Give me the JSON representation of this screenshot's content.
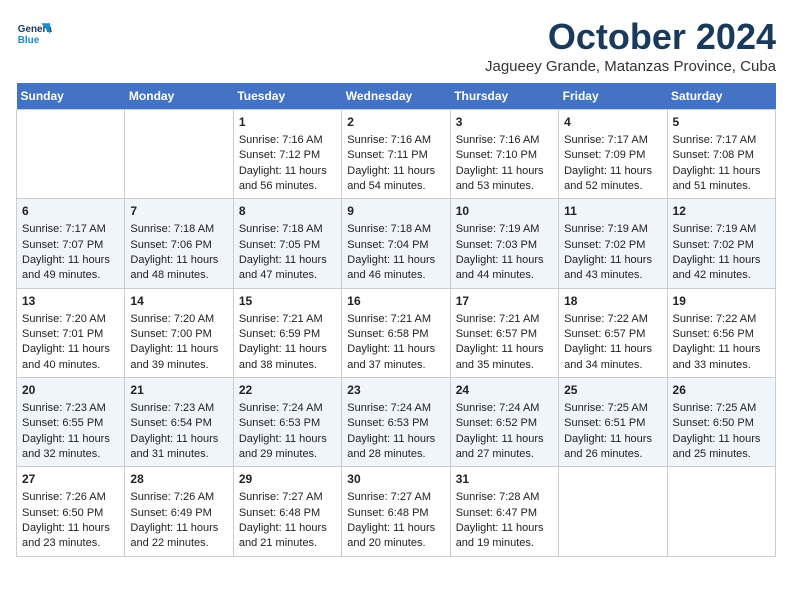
{
  "header": {
    "logo_line1": "General",
    "logo_line2": "Blue",
    "month": "October 2024",
    "location": "Jagueey Grande, Matanzas Province, Cuba"
  },
  "days_of_week": [
    "Sunday",
    "Monday",
    "Tuesday",
    "Wednesday",
    "Thursday",
    "Friday",
    "Saturday"
  ],
  "weeks": [
    [
      {
        "day": "",
        "sunrise": "",
        "sunset": "",
        "daylight": ""
      },
      {
        "day": "",
        "sunrise": "",
        "sunset": "",
        "daylight": ""
      },
      {
        "day": "1",
        "sunrise": "Sunrise: 7:16 AM",
        "sunset": "Sunset: 7:12 PM",
        "daylight": "Daylight: 11 hours and 56 minutes."
      },
      {
        "day": "2",
        "sunrise": "Sunrise: 7:16 AM",
        "sunset": "Sunset: 7:11 PM",
        "daylight": "Daylight: 11 hours and 54 minutes."
      },
      {
        "day": "3",
        "sunrise": "Sunrise: 7:16 AM",
        "sunset": "Sunset: 7:10 PM",
        "daylight": "Daylight: 11 hours and 53 minutes."
      },
      {
        "day": "4",
        "sunrise": "Sunrise: 7:17 AM",
        "sunset": "Sunset: 7:09 PM",
        "daylight": "Daylight: 11 hours and 52 minutes."
      },
      {
        "day": "5",
        "sunrise": "Sunrise: 7:17 AM",
        "sunset": "Sunset: 7:08 PM",
        "daylight": "Daylight: 11 hours and 51 minutes."
      }
    ],
    [
      {
        "day": "6",
        "sunrise": "Sunrise: 7:17 AM",
        "sunset": "Sunset: 7:07 PM",
        "daylight": "Daylight: 11 hours and 49 minutes."
      },
      {
        "day": "7",
        "sunrise": "Sunrise: 7:18 AM",
        "sunset": "Sunset: 7:06 PM",
        "daylight": "Daylight: 11 hours and 48 minutes."
      },
      {
        "day": "8",
        "sunrise": "Sunrise: 7:18 AM",
        "sunset": "Sunset: 7:05 PM",
        "daylight": "Daylight: 11 hours and 47 minutes."
      },
      {
        "day": "9",
        "sunrise": "Sunrise: 7:18 AM",
        "sunset": "Sunset: 7:04 PM",
        "daylight": "Daylight: 11 hours and 46 minutes."
      },
      {
        "day": "10",
        "sunrise": "Sunrise: 7:19 AM",
        "sunset": "Sunset: 7:03 PM",
        "daylight": "Daylight: 11 hours and 44 minutes."
      },
      {
        "day": "11",
        "sunrise": "Sunrise: 7:19 AM",
        "sunset": "Sunset: 7:02 PM",
        "daylight": "Daylight: 11 hours and 43 minutes."
      },
      {
        "day": "12",
        "sunrise": "Sunrise: 7:19 AM",
        "sunset": "Sunset: 7:02 PM",
        "daylight": "Daylight: 11 hours and 42 minutes."
      }
    ],
    [
      {
        "day": "13",
        "sunrise": "Sunrise: 7:20 AM",
        "sunset": "Sunset: 7:01 PM",
        "daylight": "Daylight: 11 hours and 40 minutes."
      },
      {
        "day": "14",
        "sunrise": "Sunrise: 7:20 AM",
        "sunset": "Sunset: 7:00 PM",
        "daylight": "Daylight: 11 hours and 39 minutes."
      },
      {
        "day": "15",
        "sunrise": "Sunrise: 7:21 AM",
        "sunset": "Sunset: 6:59 PM",
        "daylight": "Daylight: 11 hours and 38 minutes."
      },
      {
        "day": "16",
        "sunrise": "Sunrise: 7:21 AM",
        "sunset": "Sunset: 6:58 PM",
        "daylight": "Daylight: 11 hours and 37 minutes."
      },
      {
        "day": "17",
        "sunrise": "Sunrise: 7:21 AM",
        "sunset": "Sunset: 6:57 PM",
        "daylight": "Daylight: 11 hours and 35 minutes."
      },
      {
        "day": "18",
        "sunrise": "Sunrise: 7:22 AM",
        "sunset": "Sunset: 6:57 PM",
        "daylight": "Daylight: 11 hours and 34 minutes."
      },
      {
        "day": "19",
        "sunrise": "Sunrise: 7:22 AM",
        "sunset": "Sunset: 6:56 PM",
        "daylight": "Daylight: 11 hours and 33 minutes."
      }
    ],
    [
      {
        "day": "20",
        "sunrise": "Sunrise: 7:23 AM",
        "sunset": "Sunset: 6:55 PM",
        "daylight": "Daylight: 11 hours and 32 minutes."
      },
      {
        "day": "21",
        "sunrise": "Sunrise: 7:23 AM",
        "sunset": "Sunset: 6:54 PM",
        "daylight": "Daylight: 11 hours and 31 minutes."
      },
      {
        "day": "22",
        "sunrise": "Sunrise: 7:24 AM",
        "sunset": "Sunset: 6:53 PM",
        "daylight": "Daylight: 11 hours and 29 minutes."
      },
      {
        "day": "23",
        "sunrise": "Sunrise: 7:24 AM",
        "sunset": "Sunset: 6:53 PM",
        "daylight": "Daylight: 11 hours and 28 minutes."
      },
      {
        "day": "24",
        "sunrise": "Sunrise: 7:24 AM",
        "sunset": "Sunset: 6:52 PM",
        "daylight": "Daylight: 11 hours and 27 minutes."
      },
      {
        "day": "25",
        "sunrise": "Sunrise: 7:25 AM",
        "sunset": "Sunset: 6:51 PM",
        "daylight": "Daylight: 11 hours and 26 minutes."
      },
      {
        "day": "26",
        "sunrise": "Sunrise: 7:25 AM",
        "sunset": "Sunset: 6:50 PM",
        "daylight": "Daylight: 11 hours and 25 minutes."
      }
    ],
    [
      {
        "day": "27",
        "sunrise": "Sunrise: 7:26 AM",
        "sunset": "Sunset: 6:50 PM",
        "daylight": "Daylight: 11 hours and 23 minutes."
      },
      {
        "day": "28",
        "sunrise": "Sunrise: 7:26 AM",
        "sunset": "Sunset: 6:49 PM",
        "daylight": "Daylight: 11 hours and 22 minutes."
      },
      {
        "day": "29",
        "sunrise": "Sunrise: 7:27 AM",
        "sunset": "Sunset: 6:48 PM",
        "daylight": "Daylight: 11 hours and 21 minutes."
      },
      {
        "day": "30",
        "sunrise": "Sunrise: 7:27 AM",
        "sunset": "Sunset: 6:48 PM",
        "daylight": "Daylight: 11 hours and 20 minutes."
      },
      {
        "day": "31",
        "sunrise": "Sunrise: 7:28 AM",
        "sunset": "Sunset: 6:47 PM",
        "daylight": "Daylight: 11 hours and 19 minutes."
      },
      {
        "day": "",
        "sunrise": "",
        "sunset": "",
        "daylight": ""
      },
      {
        "day": "",
        "sunrise": "",
        "sunset": "",
        "daylight": ""
      }
    ]
  ]
}
